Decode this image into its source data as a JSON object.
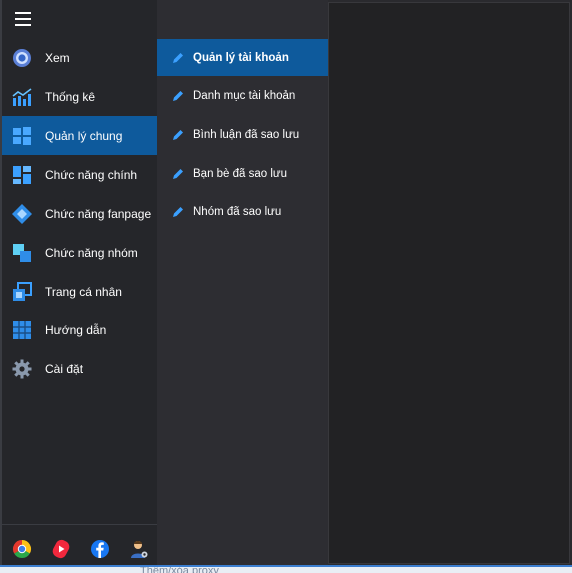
{
  "sidebar": {
    "items": [
      {
        "label": "Xem",
        "icon": "chrome-circle-icon"
      },
      {
        "label": "Thống kê",
        "icon": "stats-chart-icon"
      },
      {
        "label": "Quản lý chung",
        "icon": "windows-icon"
      },
      {
        "label": "Chức năng chính",
        "icon": "dashboard-blocks-icon"
      },
      {
        "label": "Chức năng fanpage",
        "icon": "jira-diamond-icon"
      },
      {
        "label": "Chức năng nhóm",
        "icon": "group-squares-icon"
      },
      {
        "label": "Trang cá nhân",
        "icon": "profile-window-icon"
      },
      {
        "label": "Hướng dẫn",
        "icon": "guide-grid-icon"
      },
      {
        "label": "Cài đặt",
        "icon": "gear-icon"
      }
    ],
    "active_index": 2,
    "footer_icons": [
      "chrome-icon",
      "youtube-shorts-icon",
      "facebook-icon",
      "support-agent-icon"
    ]
  },
  "submenu": {
    "items": [
      {
        "label": "Quản lý tài khoản"
      },
      {
        "label": "Danh mục tài khoản"
      },
      {
        "label": "Bình luận đã sao lưu"
      },
      {
        "label": "Bạn bè đã sao lưu"
      },
      {
        "label": "Nhóm đã sao lưu"
      }
    ],
    "active_index": 0
  },
  "background_text": "Thêm/xóa proxy",
  "colors": {
    "accent": "#0e5a9c",
    "sidebar_bg": "#25262a",
    "submenu_bg": "#2d2d32",
    "content_bg": "#222224",
    "pencil": "#3ba0ff"
  }
}
